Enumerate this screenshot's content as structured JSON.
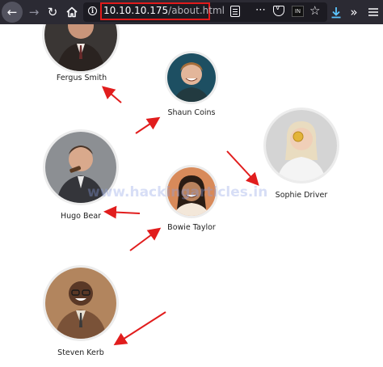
{
  "browser": {
    "url_host": "10.10.10.175",
    "url_path": "/about.html",
    "extension_badge": "IN"
  },
  "team": {
    "members": [
      {
        "name": "Fergus Smith"
      },
      {
        "name": "Shaun Coins"
      },
      {
        "name": "Sophie Driver"
      },
      {
        "name": "Hugo Bear"
      },
      {
        "name": "Bowie Taylor"
      },
      {
        "name": "Steven Kerb"
      }
    ]
  },
  "watermark": "www.hackingarticles.in",
  "colors": {
    "toolbar_bg": "#2b2a33",
    "urlbar_bg": "#1c1b22",
    "highlight_red": "#e01b1b",
    "arrow_red": "#e11d1d",
    "download_blue": "#5bc6ff"
  },
  "icons": [
    "back-arrow-icon",
    "forward-arrow-icon",
    "reload-icon",
    "home-icon",
    "info-icon",
    "reader-view-icon",
    "more-actions-icon",
    "pocket-icon",
    "extension-icon",
    "star-icon",
    "download-icon",
    "overflow-icon"
  ]
}
